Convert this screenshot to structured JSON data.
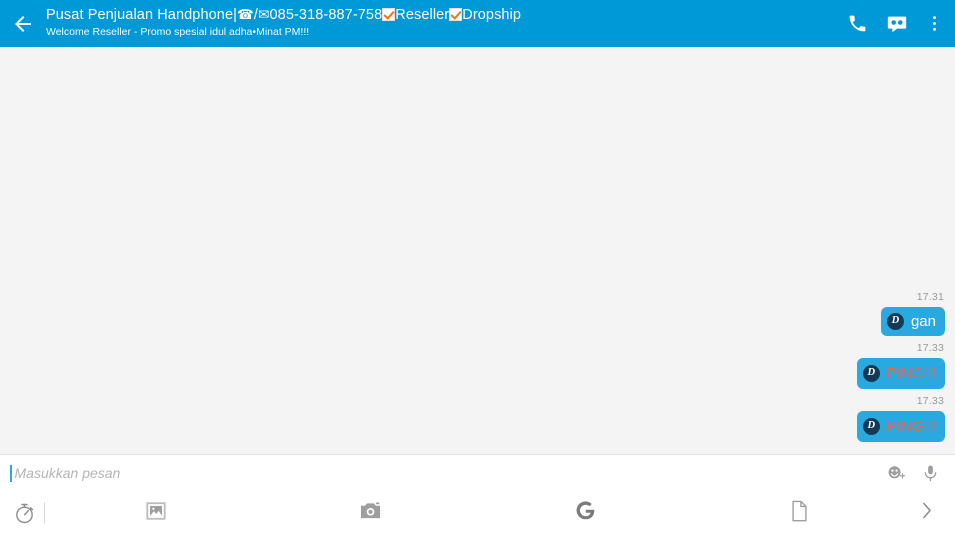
{
  "header": {
    "back_icon": "arrow-left-icon",
    "title_parts": {
      "p1": "Pusat Penjualan Handphone|",
      "phone_glyph": "☎",
      "slash": "/",
      "mail_glyph": "✉",
      "number": "085-318-887-758",
      "label1": "Reseller",
      "label2": "Dropship"
    },
    "title_plain": "Pusat Penjualan Handphone|☎/✉085-318-887-758☑Reseller☑Dropship",
    "subtitle": "Welcome Reseller - Promo spesial idul adha•Minat PM!!!",
    "actions": [
      {
        "name": "call-icon",
        "label": "Call"
      },
      {
        "name": "voicemail-icon",
        "label": "Voice message"
      },
      {
        "name": "overflow-menu-icon",
        "label": "More options"
      }
    ],
    "background_color": "#0099d8",
    "text_color": "#ffffff"
  },
  "chat": {
    "background_color": "#f4f4f4",
    "bubble_color": "#2aa8e0",
    "messages": [
      {
        "time": "17.31",
        "badge": "D",
        "text": "gan",
        "text_color": "#ffffff",
        "align": "right"
      },
      {
        "time": "17.33",
        "badge": "D",
        "text": "PING!!!",
        "text_color": "#f4604e",
        "align": "right"
      },
      {
        "time": "17.33",
        "badge": "D",
        "text": "PING!!!",
        "text_color": "#f4604e",
        "align": "right"
      }
    ]
  },
  "composer": {
    "placeholder": "Masukkan pesan",
    "value": "",
    "caret_color": "#2aa8e0",
    "right_icons": [
      {
        "name": "emoji-add-icon",
        "label": "Add sticker or emoji"
      },
      {
        "name": "microphone-icon",
        "label": "Voice input"
      }
    ]
  },
  "toolbar": {
    "items": [
      {
        "name": "timer-icon",
        "label": "Timed message"
      },
      {
        "name": "gallery-icon",
        "label": "Photo gallery"
      },
      {
        "name": "camera-icon",
        "label": "Camera"
      },
      {
        "name": "google-icon",
        "label": "Google search"
      },
      {
        "name": "file-icon",
        "label": "Attach file"
      },
      {
        "name": "send-arrow-icon",
        "label": "Send"
      }
    ]
  }
}
